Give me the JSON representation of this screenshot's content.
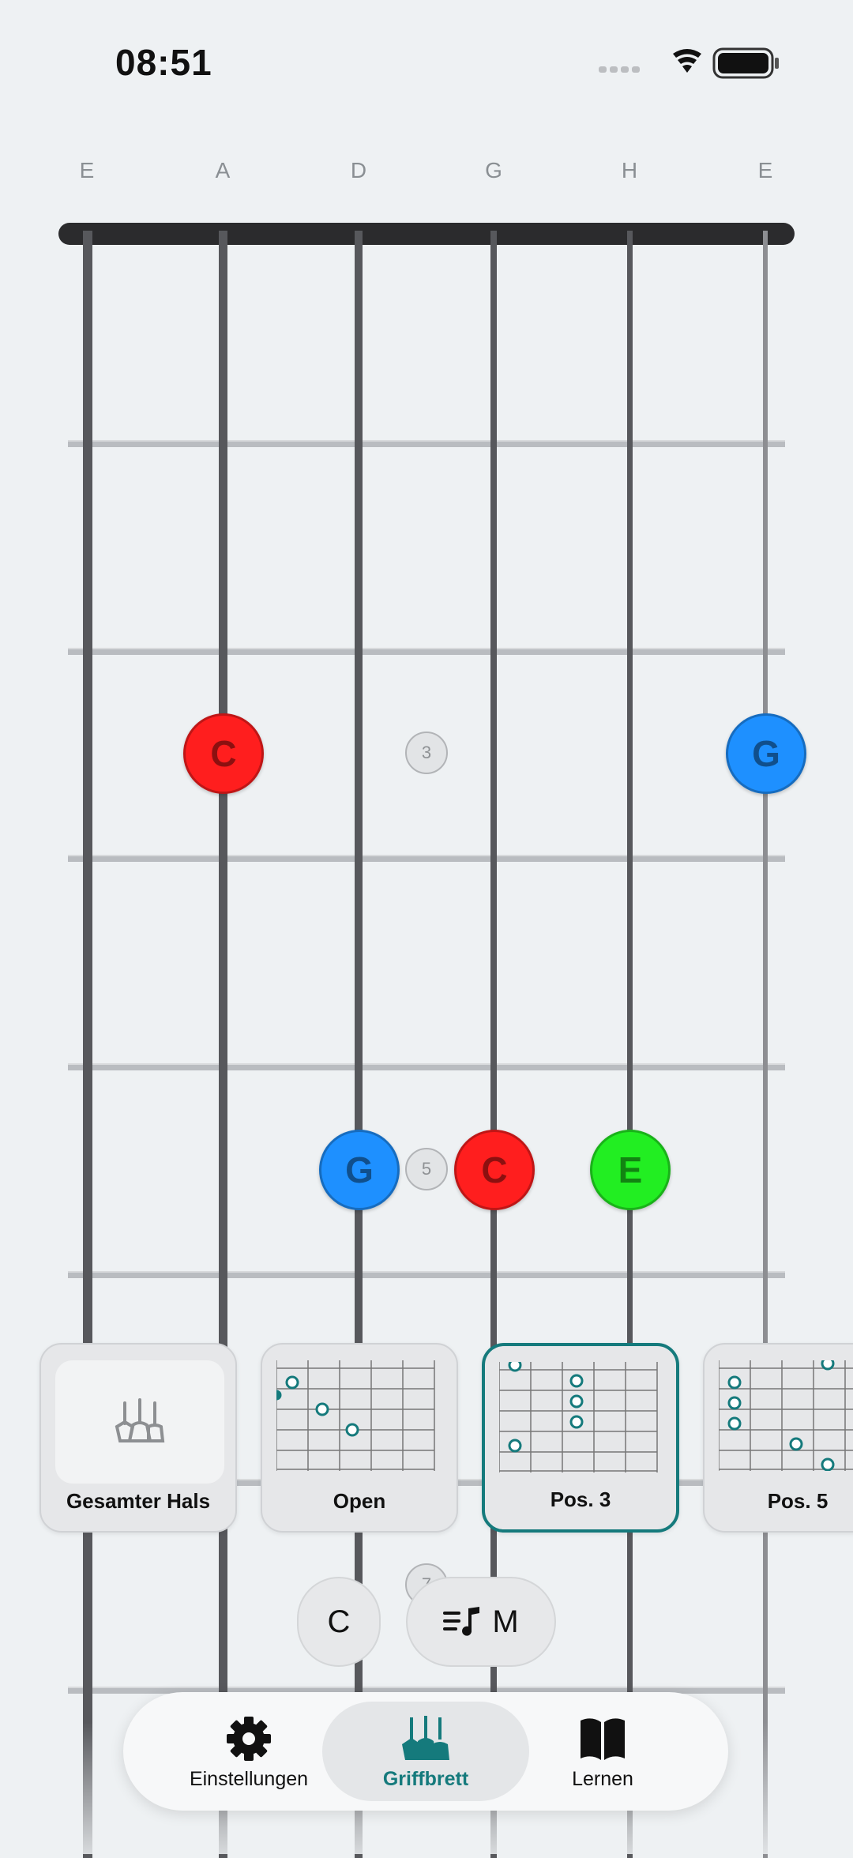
{
  "status_bar": {
    "time": "08:51",
    "icons": [
      "signal-icon",
      "wifi-icon",
      "battery-icon"
    ]
  },
  "fretboard": {
    "strings": [
      "E",
      "A",
      "D",
      "G",
      "H",
      "E"
    ],
    "notes": [
      {
        "name": "C",
        "string": 2,
        "fret": 3,
        "color": "#ff1e1e"
      },
      {
        "name": "G",
        "string": 6,
        "fret": 3,
        "color": "#1e90ff"
      },
      {
        "name": "G",
        "string": 3,
        "fret": 5,
        "color": "#1e90ff"
      },
      {
        "name": "C",
        "string": 4,
        "fret": 5,
        "color": "#ff1e1e"
      },
      {
        "name": "E",
        "string": 5,
        "fret": 5,
        "color": "#22ee22"
      }
    ],
    "fret_markers": [
      "3",
      "5",
      "7"
    ]
  },
  "positions": [
    {
      "label": "Gesamter Hals",
      "icon": "guitars-icon",
      "selected": false
    },
    {
      "label": "Open",
      "selected": false
    },
    {
      "label": "Pos. 3",
      "selected": true
    },
    {
      "label": "Pos. 5",
      "selected": false
    }
  ],
  "controls": {
    "key": "C",
    "scale": "M",
    "scale_icon": "music-list-icon"
  },
  "tabs": [
    {
      "label": "Einstellungen",
      "icon": "gear-icon",
      "active": false
    },
    {
      "label": "Griffbrett",
      "icon": "guitars-icon",
      "active": true
    },
    {
      "label": "Lernen",
      "icon": "book-icon",
      "active": false
    }
  ],
  "colors": {
    "accent": "#157a7c",
    "note_c": "#ff1e1e",
    "note_g": "#1e90ff",
    "note_e": "#22ee22"
  }
}
